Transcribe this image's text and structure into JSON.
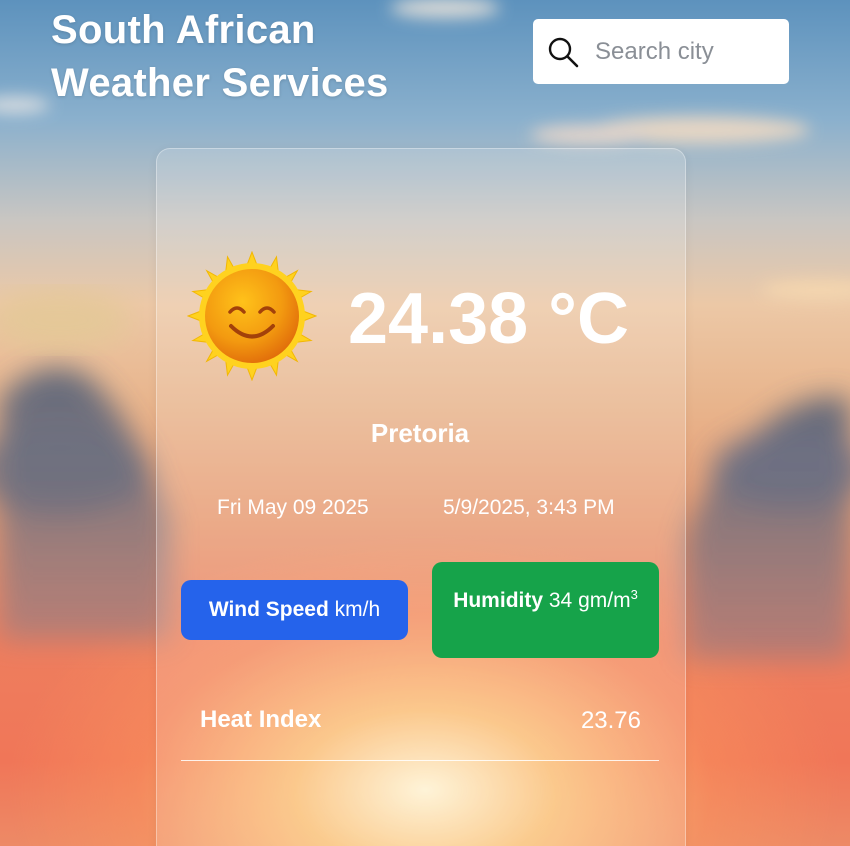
{
  "header": {
    "title_line1": "South African",
    "title_line2": "Weather Services"
  },
  "search": {
    "placeholder": "Search city",
    "value": "",
    "icon": "search-icon"
  },
  "weather": {
    "icon": "sun-smiling-icon",
    "temperature": "24.38 °C",
    "city": "Pretoria",
    "date": "Fri May 09 2025",
    "datetime": "5/9/2025, 3:43 PM",
    "wind": {
      "label": "Wind Speed",
      "unit": "km/h",
      "color": "#2563eb"
    },
    "humidity": {
      "label": "Humidity",
      "value": "34",
      "unit": "gm/m",
      "unit_superscript": "3",
      "color": "#16a34a"
    },
    "heat_index": {
      "label": "Heat Index",
      "value": "23.76"
    }
  }
}
